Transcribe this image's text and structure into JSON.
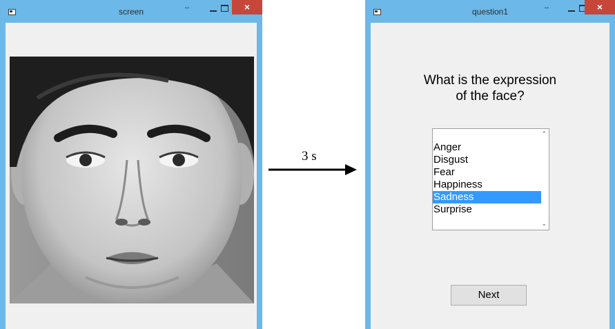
{
  "screen_window": {
    "title": "screen",
    "close_glyph": "×",
    "resize_glyph": "↔",
    "image": "face-photo"
  },
  "delay": {
    "label": "3 s"
  },
  "question_window": {
    "title": "question1",
    "close_glyph": "×",
    "resize_glyph": "↔",
    "question_line1": "What is the expression",
    "question_line2": "of the face?",
    "options": [
      "Anger",
      "Disgust",
      "Fear",
      "Happiness",
      "Sadness",
      "Surprise"
    ],
    "selected": "Sadness",
    "scroll_up_glyph": "⌃",
    "scroll_down_glyph": "⌄",
    "next_label": "Next"
  },
  "colors": {
    "window_border": "#6cb8e8",
    "close_button": "#c7463a",
    "selection": "#3399ff",
    "client_background": "#f0f0f0"
  }
}
